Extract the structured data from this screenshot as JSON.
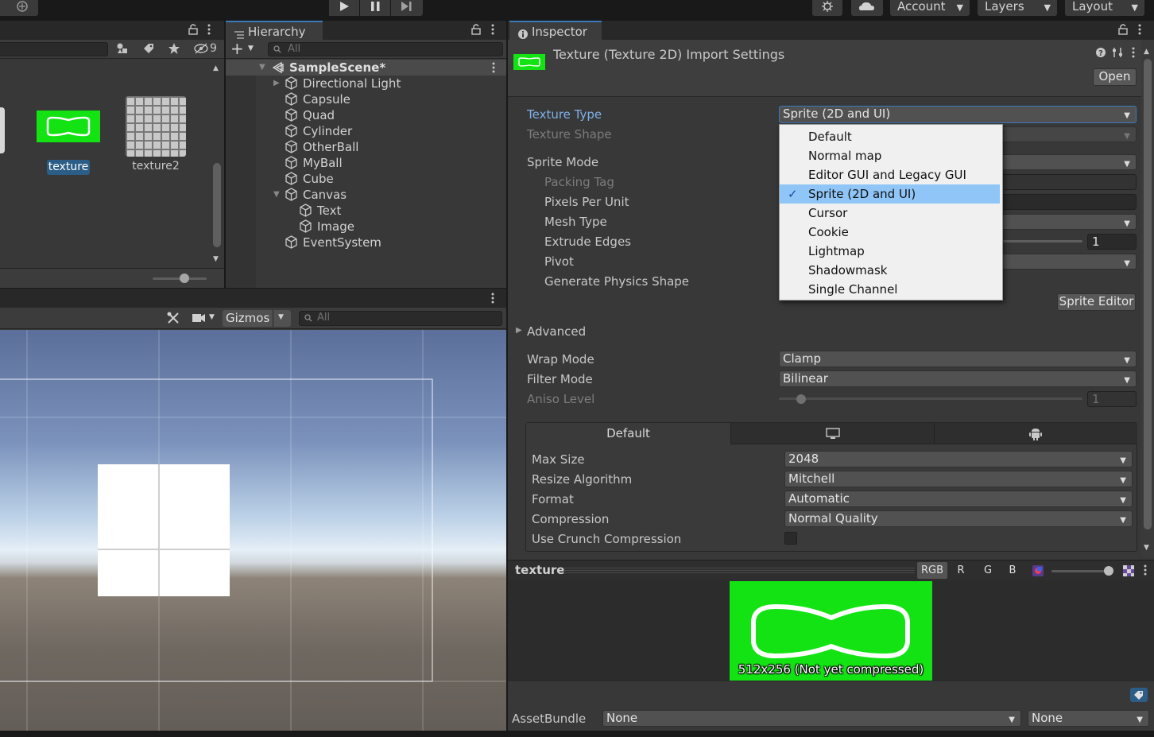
{
  "toolbar": {
    "account": "Account",
    "layers": "Layers",
    "layout": "Layout"
  },
  "project": {
    "hidden_count": "9",
    "assets": [
      {
        "name": "texture",
        "selected": true
      },
      {
        "name": "texture2",
        "selected": false
      }
    ]
  },
  "hierarchy": {
    "tab": "Hierarchy",
    "search_placeholder": "All",
    "scene": "SampleScene*",
    "items": [
      {
        "label": "Directional Light",
        "depth": 1,
        "fold": true
      },
      {
        "label": "Capsule",
        "depth": 1
      },
      {
        "label": "Quad",
        "depth": 1
      },
      {
        "label": "Cylinder",
        "depth": 1
      },
      {
        "label": "OtherBall",
        "depth": 1
      },
      {
        "label": "MyBall",
        "depth": 1
      },
      {
        "label": "Cube",
        "depth": 1
      },
      {
        "label": "Canvas",
        "depth": 1,
        "open": true
      },
      {
        "label": "Text",
        "depth": 2
      },
      {
        "label": "Image",
        "depth": 2
      },
      {
        "label": "EventSystem",
        "depth": 1
      }
    ]
  },
  "scene_view": {
    "gizmos": "Gizmos",
    "search_placeholder": "All"
  },
  "inspector": {
    "tab": "Inspector",
    "title": "Texture (Texture 2D) Import Settings",
    "open_button": "Open",
    "texture_type_label": "Texture Type",
    "texture_type_value": "Sprite (2D and UI)",
    "texture_shape_label": "Texture Shape",
    "sprite_mode_label": "Sprite Mode",
    "packing_tag_label": "Packing Tag",
    "pixels_per_unit_label": "Pixels Per Unit",
    "mesh_type_label": "Mesh Type",
    "extrude_edges_label": "Extrude Edges",
    "extrude_edges_value": "1",
    "pivot_label": "Pivot",
    "physics_shape_label": "Generate Physics Shape",
    "sprite_editor_button": "Sprite Editor",
    "advanced_label": "Advanced",
    "wrap_mode_label": "Wrap Mode",
    "wrap_mode_value": "Clamp",
    "filter_mode_label": "Filter Mode",
    "filter_mode_value": "Bilinear",
    "aniso_label": "Aniso Level",
    "aniso_value": "1",
    "platform_default_tab": "Default",
    "max_size_label": "Max Size",
    "max_size_value": "2048",
    "resize_label": "Resize Algorithm",
    "resize_value": "Mitchell",
    "format_label": "Format",
    "format_value": "Automatic",
    "compression_label": "Compression",
    "compression_value": "Normal Quality",
    "crunch_label": "Use Crunch Compression",
    "dropdown_options": [
      "Default",
      "Normal map",
      "Editor GUI and Legacy GUI",
      "Sprite (2D and UI)",
      "Cursor",
      "Cookie",
      "Lightmap",
      "Shadowmask",
      "Single Channel"
    ],
    "dropdown_selected_index": 3
  },
  "preview": {
    "name": "texture",
    "channels": [
      "RGB",
      "R",
      "G",
      "B"
    ],
    "caption": "512x256 (Not yet compressed)"
  },
  "assetbundle": {
    "label": "AssetBundle",
    "name_value": "None",
    "variant_value": "None"
  },
  "colors": {
    "accent_blue": "#3a79bb",
    "texture_green": "#13e313",
    "menu_highlight": "#8fc6f7"
  }
}
